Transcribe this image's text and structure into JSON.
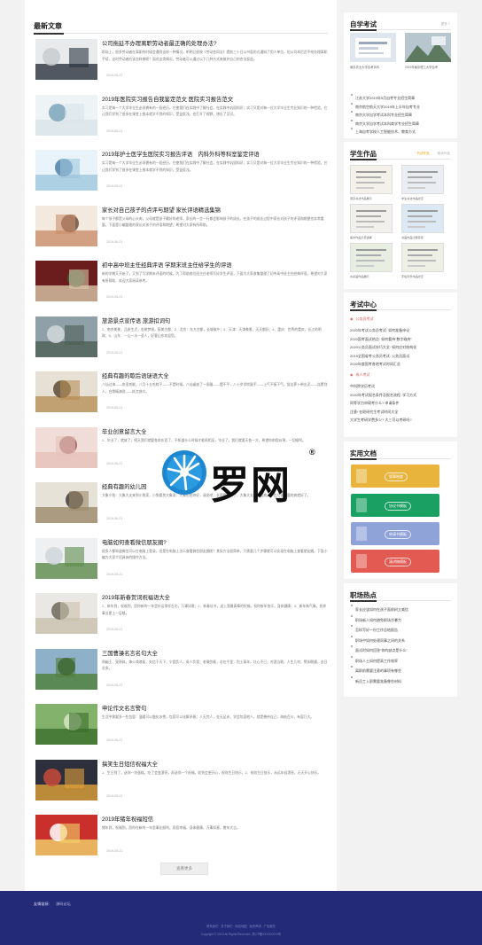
{
  "main": {
    "section_title": "最新文章",
    "load_more": "查看更多",
    "articles": [
      {
        "title": "公司拖延不办理离职劳动者最正确的处理办法?",
        "summary": "职场上，很多劳动者在离职的时候会遇到这样一种情况，明明已经按《劳动合同法》提前三十日以书面形式通知了用人单位，但公司却迟迟不给办理离职手续，这时劳动者应该怎样做呢？面对这类情况，劳动者可以通过以下几种方式来维护自己的合法权益。",
        "date": "2019-05-21"
      },
      {
        "title": "2019年医院实习报告自我鉴定范文 医院实习报告范文",
        "summary": "实习是每一个大学毕业生必须拥有的一段经历，它使我们在实践中了解社会，在实践中巩固知识；实习又是对每一位大学毕业生专业知识的一种检验，它让我们学到了很多在课堂上根本就学不到的知识，受益匪浅，也打开了视野，增长了见识。",
        "date": "2019-05-21"
      },
      {
        "title": "2019年护士医学生医院实习报告评语　内科外科等科室鉴定评语",
        "summary": "实习是每一个大学毕业生必须拥有的一段经历，它使我们在实践中了解社会，在实践中巩固知识；实习又是对每一位大学毕业生专业知识的一种检验，它让我们学到了很多在课堂上根本就学不到的知识，受益匪浅。",
        "date": "2019-05-21"
      },
      {
        "title": "家长对自己孩子的点评与期望 家长评语精选集锦",
        "summary": "每个孩子都是父母的心头肉，父母就是孩子最好的老师。家长的一言一行都会影响孩子的成长，在孩子的成长过程中家长对孩子的评语和期望也非常重要，下面是小编整理的家长对孩子的评语和期望，希望对大家有所帮助。",
        "date": "2019-05-21"
      },
      {
        "title": "初中高中班主任经典评语 学期末班主任给学生的评语",
        "summary": "新的学期又开始了，又到了写学期末评语的时候，为了帮助各位班主任老师写好学生评语，下面为大家收集整理了初中高中班主任经典评语，希望对大家有所帮助，欢迎大家阅读参考。",
        "date": "2019-05-21"
      },
      {
        "title": "旅游景点宣传语 旅游扣词句",
        "summary": "1、南京美景，品质生活，金陵梦境，醉美古都；2、北京：东方古都，长城故乡；3、天津：天津美景，天天都好；4、重庆：世界的重庆，长江的明珠；5、山东：一山一水一圣人，好客山东欢迎您。",
        "date": "2019-05-21"
      },
      {
        "title": "经典有趣的歇后语谜语大全",
        "summary": "八仙过海——各显其能，八月十五吃粽子——不是时候，八仙桌缺了一条腿——摆不平，八十岁学吹鼓手——上气不接下气，拔出萝卜带出泥——连累别人，白骨精演说——妖言惑众。",
        "date": "2019-05-21"
      },
      {
        "title": "毕业创意留言大全",
        "summary": "1、毕业了，就放了，明天我们就要各奔东西了，不知道什么时候才能再相见，毕业了，我们就要天各一方，希望你前程似锦，一切顺利。",
        "date": "2019-05-21"
      },
      {
        "title": "经典有趣的幼儿园",
        "summary": "大象小兔：大象大夫来到小兔家，小兔看到大象说：大象伯伯你好，请坐吧；长颈鹿生病了，大象大夫给它看病，一会儿长颈鹿的病就好了。",
        "date": "2019-05-21"
      },
      {
        "title": "电脑如何查看微信朋友圈?",
        "summary": "很多人都知道微信可以在电脑上登录，但是在电脑上怎么查看微信朋友圈呢？其实方法很简单，只需要几个步骤就可以实现在电脑上查看朋友圈。下面小编为大家介绍具体的操作方法。",
        "date": "2019-05-21"
      },
      {
        "title": "2019年新春贺词祝福语大全",
        "summary": "1、新年到，祝福到，愿你新的一年里好运常伴左右，万事如意；2、新春佳节，送上我最真挚的祝福，祝你新年快乐，身体健康；3、新年新气象，祝你事业更上一层楼。",
        "date": "2019-05-21"
      },
      {
        "title": "三国曹操名言名句大全",
        "summary": "周幽王、宠褒姒，烽火戏诸侯，失信于天下；宁我负人，毋人负我；老骥伏枥，志在千里；烈士暮年，壮心不已；对酒当歌，人生几何；譬如朝露，去日苦多。",
        "date": "2019-05-21"
      },
      {
        "title": "申论作文名言警句",
        "summary": "生活中需要多一些包容：温暖可以融化冰雪，包容可以化解矛盾；人无完人，金无足赤，学会包容他人，就是善待自己；海纳百川，有容乃大。",
        "date": "2019-05-21"
      },
      {
        "title": "搞笑生日短信祝福大全",
        "summary": "1、生日到了，送你一块蛋糕，吃了会变漂亮，再送你一个祝福，收到会更开心，祝你生日快乐；2、祝你生日快乐，永远年轻漂亮，天天开心快乐。",
        "date": "2019-05-21"
      },
      {
        "title": "2019年猪年祝福短信",
        "summary": "猪年到，祝福到，愿你在新的一年里事业顺利，家庭幸福，身体健康，万事如意，猪年大吉。",
        "date": "2019-05-21"
      }
    ]
  },
  "sidebar": {
    "zikao": {
      "title": "自学考试",
      "more": "更多 +",
      "images": [
        {
          "caption": "南京农业大学自考本科"
        },
        {
          "caption": "2019年南京理工大学自考"
        }
      ],
      "links": [
        "江苏大学2019年5月自考专业招生简章",
        "南京航空航天大学2019年上半年自考专业",
        "南京大学自学考试本科专业招生简章",
        "南京大学自学考试本科商学专业招生简章",
        "上海自考学校人工智能技术、教育方式"
      ]
    },
    "works": {
      "title": "学生作品",
      "tabs": [
        "书法作品",
        "美术作品"
      ],
      "items": [
        {
          "caption": "南京书法作品展示"
        },
        {
          "caption": "学生书法作品欣赏"
        },
        {
          "caption": "美术作品示范讲解"
        },
        {
          "caption": "书画作品比赛获奖"
        },
        {
          "caption": "水彩画作品展示"
        },
        {
          "caption": "手绘风景作品欣赏"
        }
      ]
    },
    "exams": {
      "title": "考试中心",
      "cat1": "公务员考试",
      "list1": [
        "2020年考试公务员考试: 如何准备申论",
        "2020国考面试热点: 如何看待\"数字政府\"",
        "2020公务员面试技巧大全: 如何应对结构化",
        "2019全国省考公务员考试: 公务员面试",
        "2020年度国考各地考试时间汇总"
      ],
      "cat2": "成人考试",
      "list2": [
        "中科院学历考试",
        "2020年考试报名条件及报名流程: 学习方式",
        "同等学力申硕考什么? 申请条件",
        "注意! 在职研究生考试时间大全",
        "大学生考研学费多少? 大三可以考研吗?"
      ]
    },
    "docs": {
      "title": "实用文档",
      "buttons": [
        {
          "label": "规章制度",
          "color": "#e9b43c"
        },
        {
          "label": "协议书模板",
          "color": "#1aa062"
        },
        {
          "label": "申请书模板",
          "color": "#8fa3d9"
        },
        {
          "label": "演讲稿模板",
          "color": "#e25a52"
        }
      ]
    },
    "jobs": {
      "title": "职场热点",
      "links": [
        "家长应该如何在孩子面前树立威信",
        "职场新人如何避免职场冷暴力",
        "怎样写好一份工作总结报告",
        "职场中如何处理同事之间的关系",
        "面试时如何回答\"你的缺点是什么\"",
        "职场人士如何提高工作效率",
        "离职前需要注意的事项有哪些",
        "新员工入职需要准备哪些材料"
      ]
    }
  },
  "footer": {
    "links_label": "友情链接:",
    "link1": "源码论坛",
    "line1": "联系我们 · 关于我们 · 网站地图 · 免责声明 · 广告服务",
    "line2": "Copyright © 2019 All Rights Reserved. 苏ICP备XXXXXXXX号"
  },
  "watermark": {
    "text": "罗网",
    "reg": "®"
  }
}
